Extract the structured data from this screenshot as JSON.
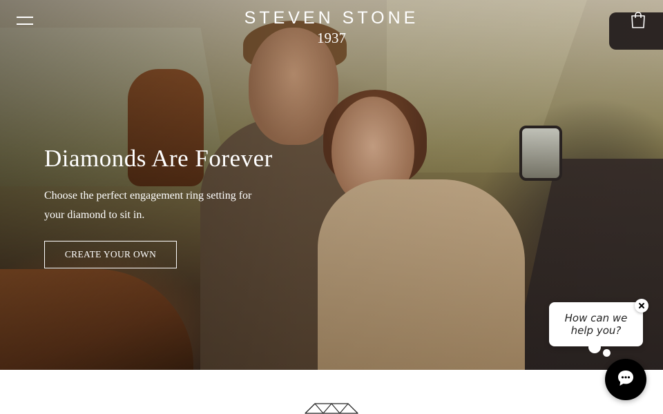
{
  "header": {
    "brand_name": "STEVEN STONE",
    "brand_year": "1937",
    "menu_icon": "hamburger-menu-icon",
    "cart_icon": "shopping-bag-icon"
  },
  "hero": {
    "title": "Diamonds Are Forever",
    "subtitle": "Choose the perfect engagement ring setting for your diamond to sit in.",
    "cta_label": "CREATE YOUR OWN",
    "text_color": "#ffffff"
  },
  "chat": {
    "prompt": "How can we help you?",
    "close_icon": "close-icon",
    "launcher_icon": "chat-icon",
    "launcher_color": "#000000"
  },
  "below_hero": {
    "icon": "diamond-icon"
  }
}
